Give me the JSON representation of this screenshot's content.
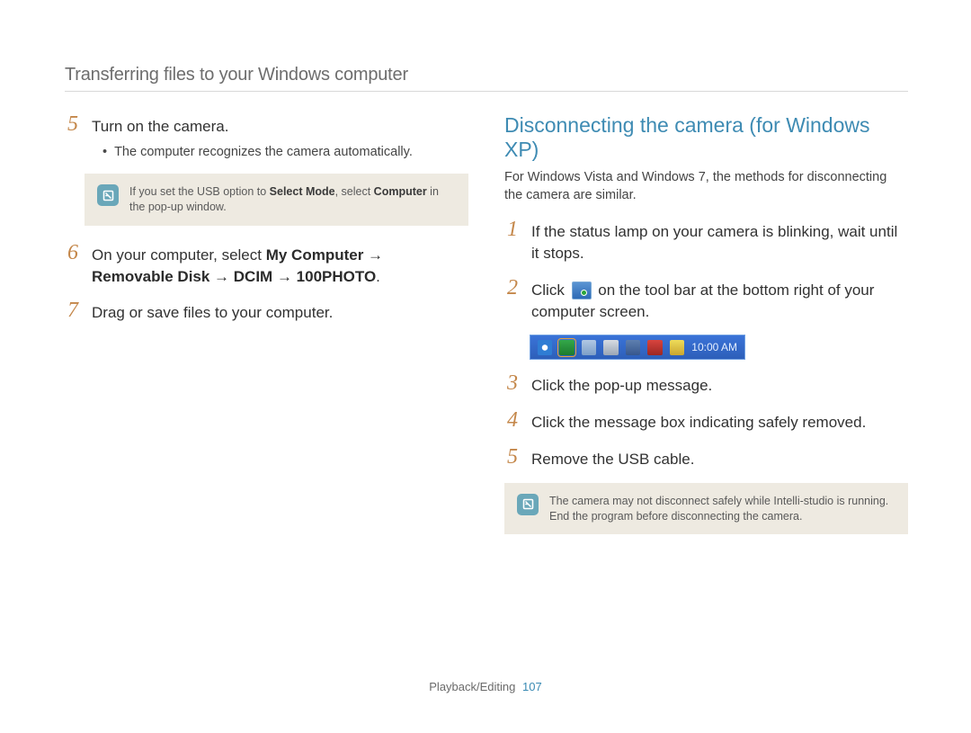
{
  "header": {
    "title": "Transferring files to your Windows computer"
  },
  "left": {
    "steps": {
      "s5": {
        "num": "5",
        "text": "Turn on the camera.",
        "bullet": "The computer recognizes the camera automatically."
      },
      "note": {
        "pre": "If you set the USB option to ",
        "b1": "Select Mode",
        "mid": ", select ",
        "b2": "Computer",
        "post": " in the pop-up window."
      },
      "s6": {
        "num": "6",
        "pre": "On your computer, select ",
        "bold": "My Computer → Removable Disk → DCIM → 100PHOTO",
        "post": "."
      },
      "s7": {
        "num": "7",
        "text": "Drag or save files to your computer."
      }
    }
  },
  "right": {
    "heading": "Disconnecting the camera (for Windows XP)",
    "subtext": "For Windows Vista and Windows 7, the methods for disconnecting the camera are similar.",
    "steps": {
      "s1": {
        "num": "1",
        "text": "If the status lamp on your camera is blinking, wait until it stops."
      },
      "s2": {
        "num": "2",
        "pre": "Click ",
        "post": " on the tool bar at the bottom right of your computer screen."
      },
      "s3": {
        "num": "3",
        "text": "Click the pop-up message."
      },
      "s4": {
        "num": "4",
        "text": "Click the message box indicating safely removed."
      },
      "s5": {
        "num": "5",
        "text": "Remove the USB cable."
      }
    },
    "taskbar": {
      "clock": "10:00 AM"
    },
    "note": {
      "text": "The camera may not disconnect safely while Intelli-studio is running. End the program before disconnecting the camera."
    }
  },
  "footer": {
    "section": "Playback/Editing",
    "page": "107"
  }
}
